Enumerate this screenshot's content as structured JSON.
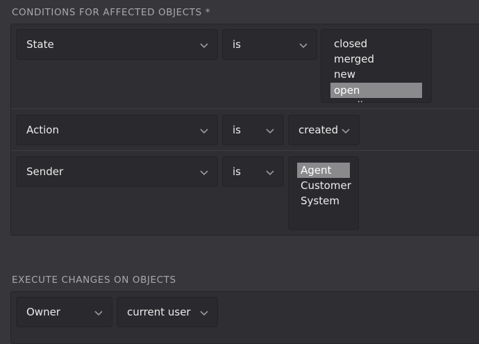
{
  "conditions": {
    "title": "CONDITIONS FOR AFFECTED OBJECTS *",
    "rows": [
      {
        "attribute": "State",
        "operator": "is",
        "options": [
          "closed",
          "merged",
          "new",
          "open"
        ],
        "selected": "open",
        "partial_option": "pending"
      },
      {
        "attribute": "Action",
        "operator": "is",
        "value": "created"
      },
      {
        "attribute": "Sender",
        "operator": "is",
        "options": [
          "Agent",
          "Customer",
          "System"
        ],
        "selected": "Agent"
      }
    ]
  },
  "execute": {
    "title": "EXECUTE CHANGES ON OBJECTS",
    "attribute": "Owner",
    "value": "current user"
  },
  "icons": {
    "chevron": "chevron-down-icon"
  },
  "colors": {
    "background": "#37373b",
    "panel": "#2f2f33",
    "control": "#2a2a2e",
    "selected_option": "#8a8a8c"
  }
}
